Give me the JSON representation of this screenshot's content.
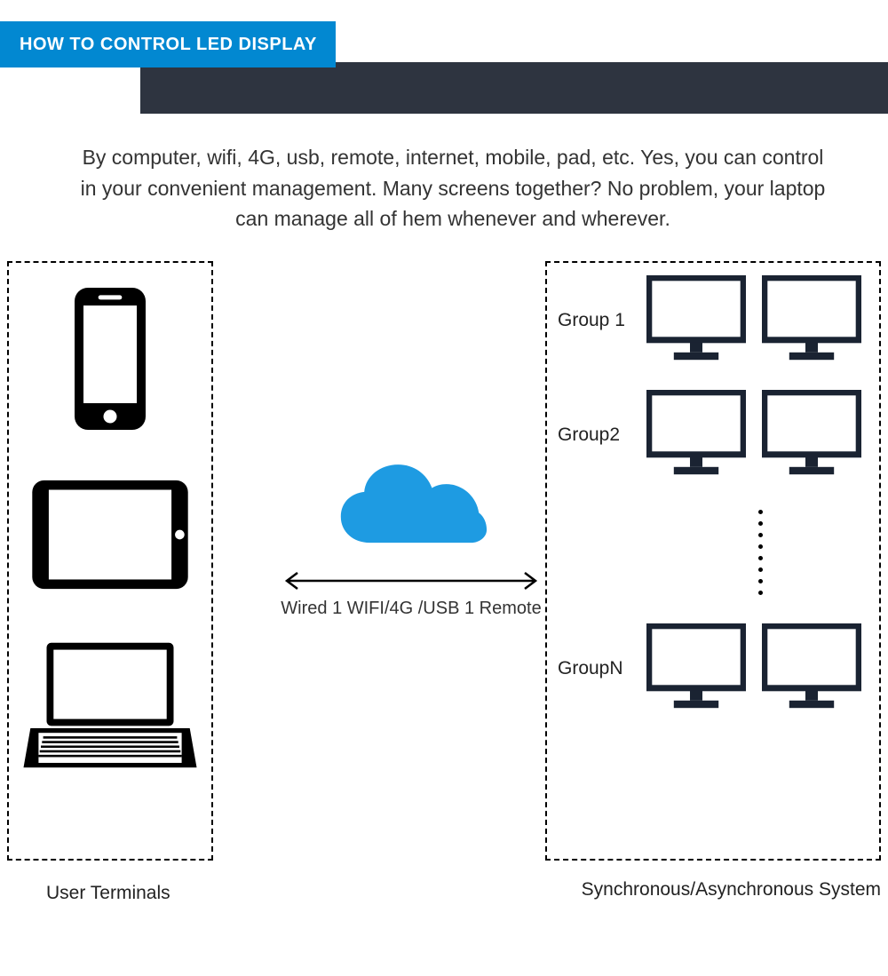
{
  "header": {
    "title": "HOW TO CONTROL LED DISPLAY"
  },
  "description": "By computer, wifi, 4G, usb, remote, internet, mobile, pad, etc. Yes, you can control in your convenient management. Many screens together? No problem, your laptop can manage all of hem whenever and wherever.",
  "diagram": {
    "left_caption": "User Terminals",
    "right_caption": "Synchronous/Asynchronous System",
    "connection_label": "Wired 1 WIFI/4G /USB 1 Remote",
    "groups": {
      "g1": "Group 1",
      "g2": "Group2",
      "gn": "GroupN"
    }
  },
  "chart_data": {
    "type": "diagram",
    "title": "HOW TO CONTROL LED DISPLAY",
    "nodes": {
      "user_terminals": {
        "label": "User Terminals",
        "devices": [
          "smartphone",
          "tablet",
          "laptop"
        ]
      },
      "cloud": {
        "label": "cloud",
        "connection_methods": "Wired 1 WIFI/4G /USB 1 Remote"
      },
      "display_system": {
        "label": "Synchronous/Asynchronous System",
        "groups": [
          "Group 1",
          "Group2",
          "...",
          "GroupN"
        ],
        "monitors_per_group": 2
      }
    },
    "edges": [
      {
        "from": "user_terminals",
        "to": "display_system",
        "via": "cloud",
        "bidirectional": true
      }
    ]
  }
}
